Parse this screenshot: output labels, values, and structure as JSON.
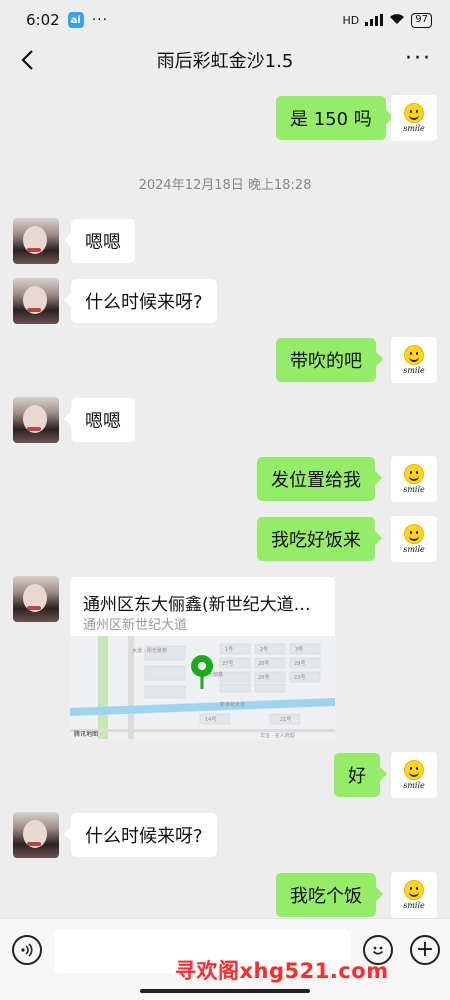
{
  "status_bar": {
    "time": "6:02",
    "app_badge": "ai",
    "dots": "···",
    "network": "HD",
    "battery": "97"
  },
  "header": {
    "title": "雨后彩虹金沙1.5",
    "more": "···"
  },
  "timestamp": "2024年12月18日 晚上18:28",
  "messages": [
    {
      "from": "me",
      "text": "是 150 吗"
    },
    {
      "from": "contact",
      "text": "嗯嗯"
    },
    {
      "from": "contact",
      "text": "什么时候来呀?"
    },
    {
      "from": "me",
      "text": "带吹的吧"
    },
    {
      "from": "contact",
      "text": "嗯嗯"
    },
    {
      "from": "me",
      "text": "发位置给我"
    },
    {
      "from": "me",
      "text": "我吃好饭来"
    },
    {
      "from": "me",
      "text": "好"
    },
    {
      "from": "contact",
      "text": "什么时候来呀?"
    },
    {
      "from": "me",
      "text": "我吃个饭"
    }
  ],
  "location": {
    "title": "通州区东大俪鑫(新世纪大道…",
    "address": "通州区新世纪大道",
    "map_credit": "腾讯地图",
    "map_labels": [
      "大道 · 阳光景苑",
      "1号",
      "2号",
      "3号",
      "大俪鑫",
      "新世纪大道",
      "华宝 · 名人府邸",
      "27号",
      "28号",
      "29号",
      "21号",
      "28号",
      "23号",
      "14号"
    ]
  },
  "me_avatar_text": "smile",
  "input_bar": {
    "placeholder": "",
    "plus": "+"
  },
  "watermark": "寻欢阁xhg521.com",
  "colors": {
    "my_bubble": "#95ec69",
    "contact_bubble": "#ffffff",
    "background": "#ededed",
    "map_pin": "#1aad19"
  }
}
